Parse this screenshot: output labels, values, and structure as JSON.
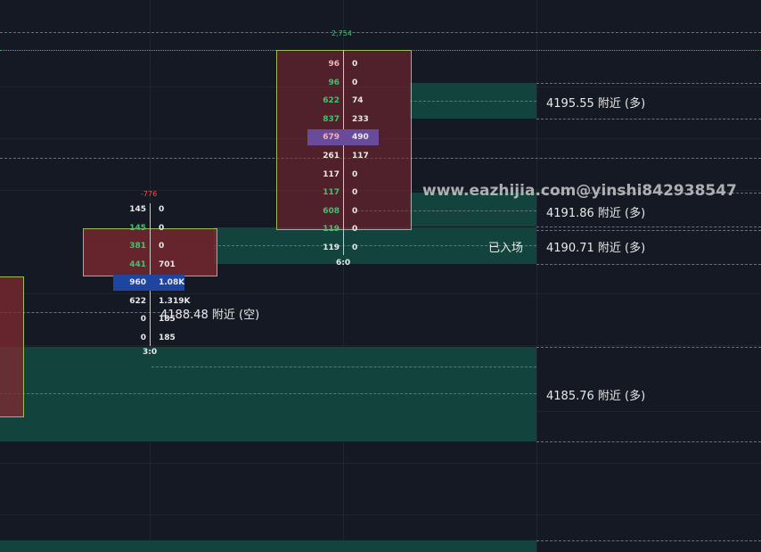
{
  "watermark": "www.eazhijia.com@yinshi842938547",
  "levels": {
    "l1": "4195.55 附近 (多)",
    "l2": "4191.86 附近 (多)",
    "l3": "4190.71 附近 (多)",
    "l4": "4188.48 附近 (空)",
    "l5": "4185.76 附近 (多)",
    "entered": "已入场"
  },
  "bar1": {
    "delta": "-776",
    "footer": "3:0",
    "rows": [
      {
        "bid": "145",
        "ask": "0"
      },
      {
        "bid": "145",
        "ask": "0"
      },
      {
        "bid": "381",
        "ask": "0"
      },
      {
        "bid": "441",
        "ask": "701"
      },
      {
        "bid": "960",
        "ask": "1.08K"
      },
      {
        "bid": "622",
        "ask": "1.319K"
      },
      {
        "bid": "0",
        "ask": "185"
      },
      {
        "bid": "0",
        "ask": "185"
      }
    ]
  },
  "bar2": {
    "delta": "2,754",
    "footer": "6:0",
    "rows": [
      {
        "bid": "96",
        "ask": "0"
      },
      {
        "bid": "96",
        "ask": "0"
      },
      {
        "bid": "622",
        "ask": "74"
      },
      {
        "bid": "837",
        "ask": "233"
      },
      {
        "bid": "679",
        "ask": "490"
      },
      {
        "bid": "261",
        "ask": "117"
      },
      {
        "bid": "117",
        "ask": "0"
      },
      {
        "bid": "117",
        "ask": "0"
      },
      {
        "bid": "608",
        "ask": "0"
      },
      {
        "bid": "119",
        "ask": "0"
      },
      {
        "bid": "119",
        "ask": "0"
      }
    ]
  },
  "colors": {
    "background": "#151924",
    "zone_green": "#12463f",
    "box_red": "#822830",
    "poc_blue": "#1f45a0",
    "poc_purple": "#6a4a9a",
    "delta_pos": "#3ec46d",
    "delta_neg": "#f05050"
  }
}
